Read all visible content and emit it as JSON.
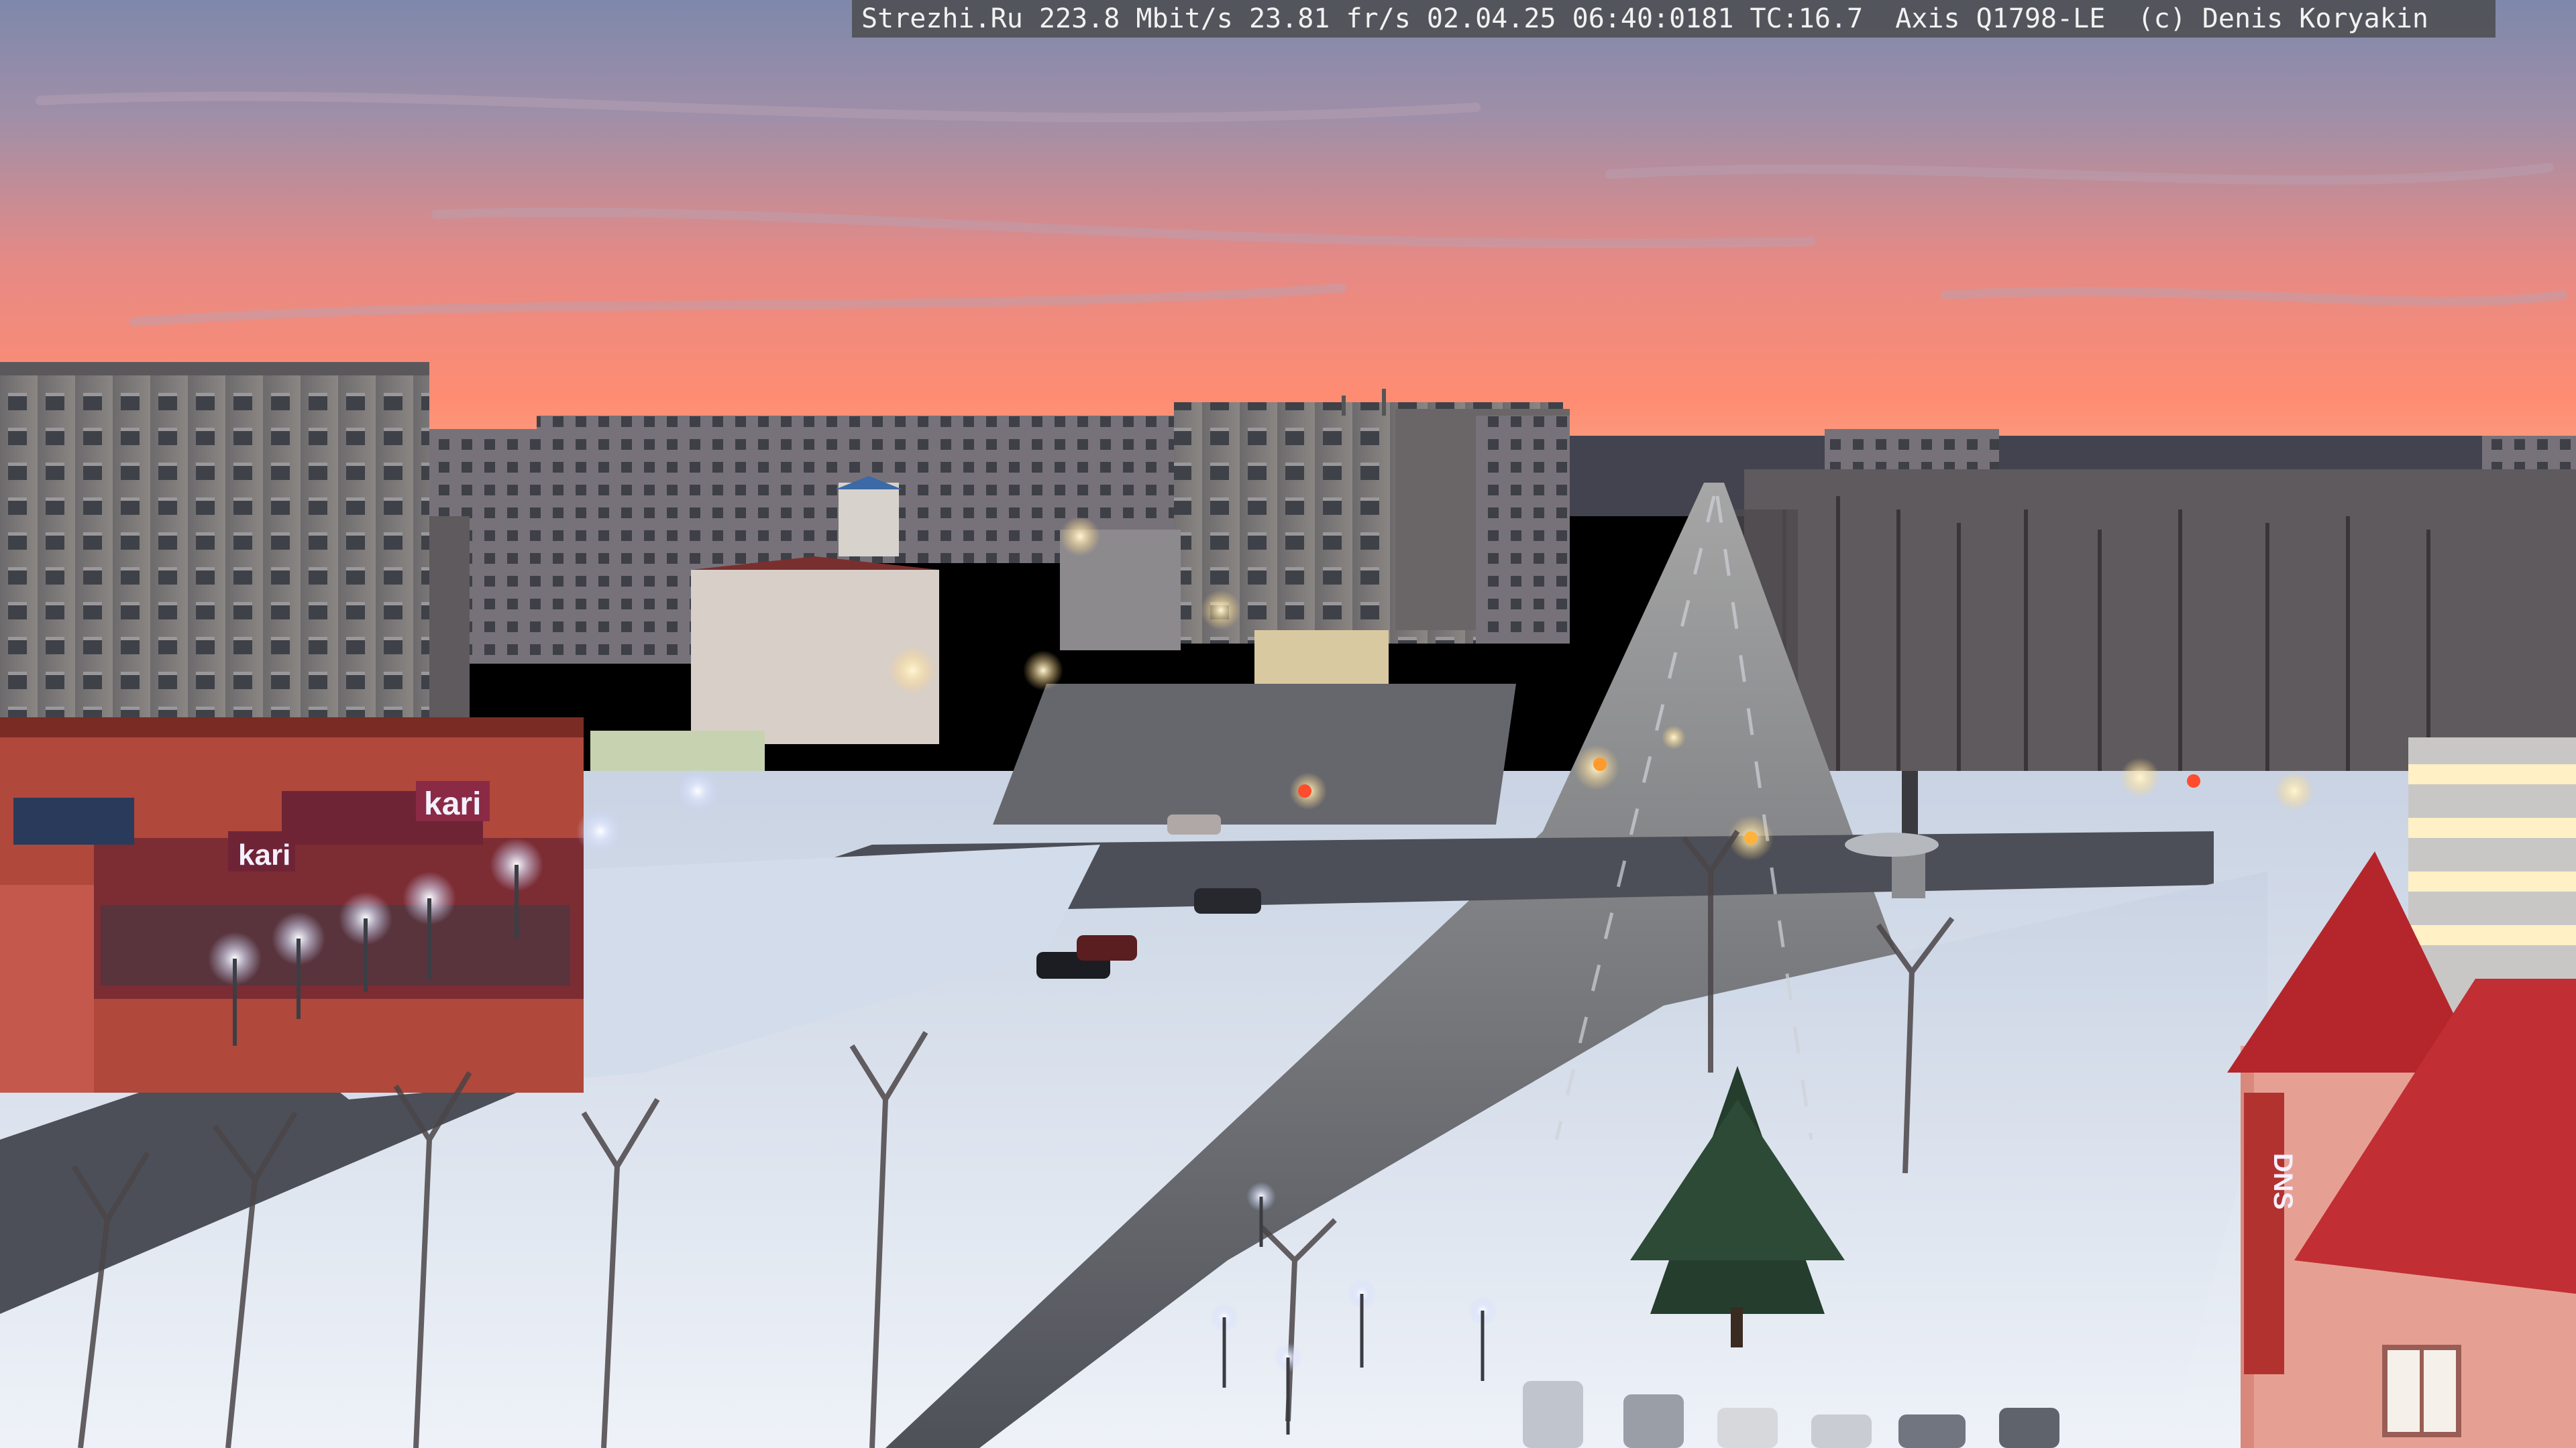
{
  "overlay": {
    "text": "Strezhi.Ru 223.8 Mbit/s 23.81 fr/s 02.04.25 06:40:0181 TC:16.7  Axis Q1798-LE  (c) Denis Koryakin"
  },
  "signs": {
    "store_left": "kari",
    "store_center": "kari",
    "store_right": "DNS"
  },
  "colors": {
    "sky_top": "#8a93b5",
    "sky_horizon": "#ff8a6e",
    "snow": "#dfe6f2",
    "asphalt": "#5b5e66",
    "brick": "#b0483b",
    "roof_red": "#b4262c"
  }
}
